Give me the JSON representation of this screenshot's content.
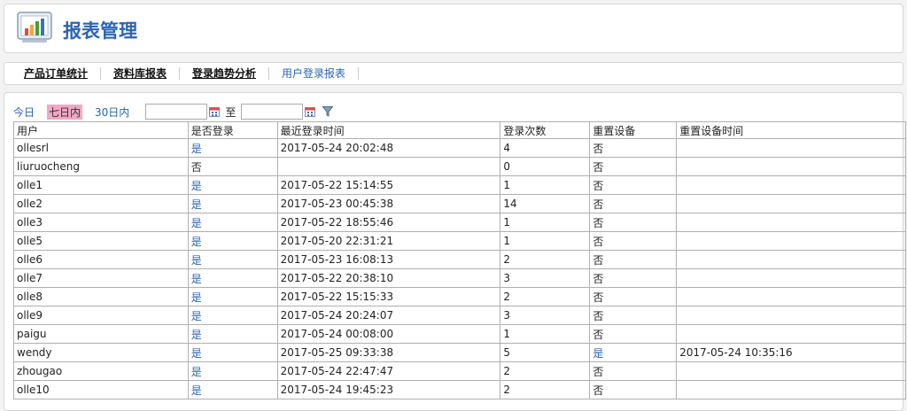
{
  "header": {
    "title": "报表管理"
  },
  "tabs": [
    {
      "label": "产品订单统计",
      "active": false
    },
    {
      "label": "资料库报表",
      "active": false
    },
    {
      "label": "登录趋势分析",
      "active": false
    },
    {
      "label": "用户登录报表",
      "active": true
    }
  ],
  "filter": {
    "today": "今日",
    "seven_days": "七日内",
    "thirty_days": "30日内",
    "start_date": "",
    "to_label": "至",
    "end_date": ""
  },
  "table": {
    "columns": [
      "用户",
      "是否登录",
      "最近登录时间",
      "登录次数",
      "重置设备",
      "重置设备时间"
    ],
    "rows": [
      [
        "ollesrl",
        "是",
        "2017-05-24 20:02:48",
        "4",
        "否",
        ""
      ],
      [
        "liuruocheng",
        "否",
        "",
        "0",
        "否",
        ""
      ],
      [
        "olle1",
        "是",
        "2017-05-22 15:14:55",
        "1",
        "否",
        ""
      ],
      [
        "olle2",
        "是",
        "2017-05-23 00:45:38",
        "14",
        "否",
        ""
      ],
      [
        "olle3",
        "是",
        "2017-05-22 18:55:46",
        "1",
        "否",
        ""
      ],
      [
        "olle5",
        "是",
        "2017-05-20 22:31:21",
        "1",
        "否",
        ""
      ],
      [
        "olle6",
        "是",
        "2017-05-23 16:08:13",
        "2",
        "否",
        ""
      ],
      [
        "olle7",
        "是",
        "2017-05-22 20:38:10",
        "3",
        "否",
        ""
      ],
      [
        "olle8",
        "是",
        "2017-05-22 15:15:33",
        "2",
        "否",
        ""
      ],
      [
        "olle9",
        "是",
        "2017-05-24 20:24:07",
        "3",
        "否",
        ""
      ],
      [
        "paigu",
        "是",
        "2017-05-24 00:08:00",
        "1",
        "否",
        ""
      ],
      [
        "wendy",
        "是",
        "2017-05-25 09:33:38",
        "5",
        "是",
        "2017-05-24 10:35:16"
      ],
      [
        "zhougao",
        "是",
        "2017-05-24 22:47:47",
        "2",
        "否",
        ""
      ],
      [
        "olle10",
        "是",
        "2017-05-24 19:45:23",
        "2",
        "否",
        ""
      ]
    ]
  },
  "colors": {
    "accent": "#2a64b4",
    "selected_bg": "#f1a8c4"
  }
}
